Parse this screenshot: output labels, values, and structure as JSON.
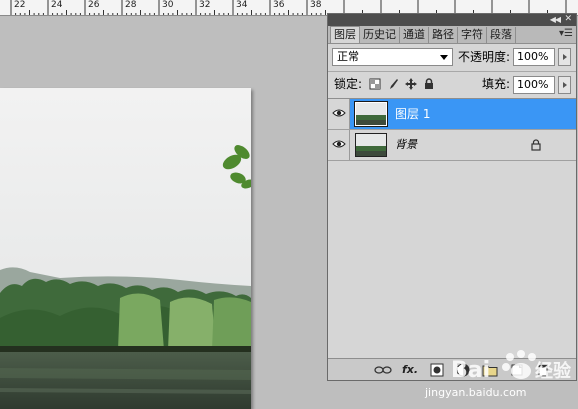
{
  "ruler": {
    "labels": [
      "22",
      "24",
      "26",
      "28",
      "30",
      "32",
      "34",
      "36",
      "38"
    ]
  },
  "layers_panel": {
    "tabs": [
      "图层",
      "历史记",
      "通道",
      "路径",
      "字符",
      "段落"
    ],
    "active_tab": "图层",
    "blend_mode": "正常",
    "opacity_label": "不透明度:",
    "opacity_value": "100%",
    "lock_label": "锁定:",
    "fill_label": "填充:",
    "fill_value": "100%",
    "layers": [
      {
        "name": "图层 1",
        "selected": true,
        "visible": true,
        "locked": false
      },
      {
        "name": "背景",
        "selected": false,
        "visible": true,
        "locked": true
      }
    ],
    "footer_icons": [
      "link-icon",
      "fx-icon",
      "mask-icon",
      "adjustment-icon",
      "folder-icon",
      "new-layer-icon",
      "trash-icon"
    ],
    "fx_label": "fx."
  },
  "watermark": {
    "brand": "Baidu 经验",
    "url": "jingyan.baidu.com"
  },
  "colors": {
    "selection": "#3a96f5",
    "panel_bg": "#d6d6d6",
    "workspace_bg": "#bebebe"
  }
}
